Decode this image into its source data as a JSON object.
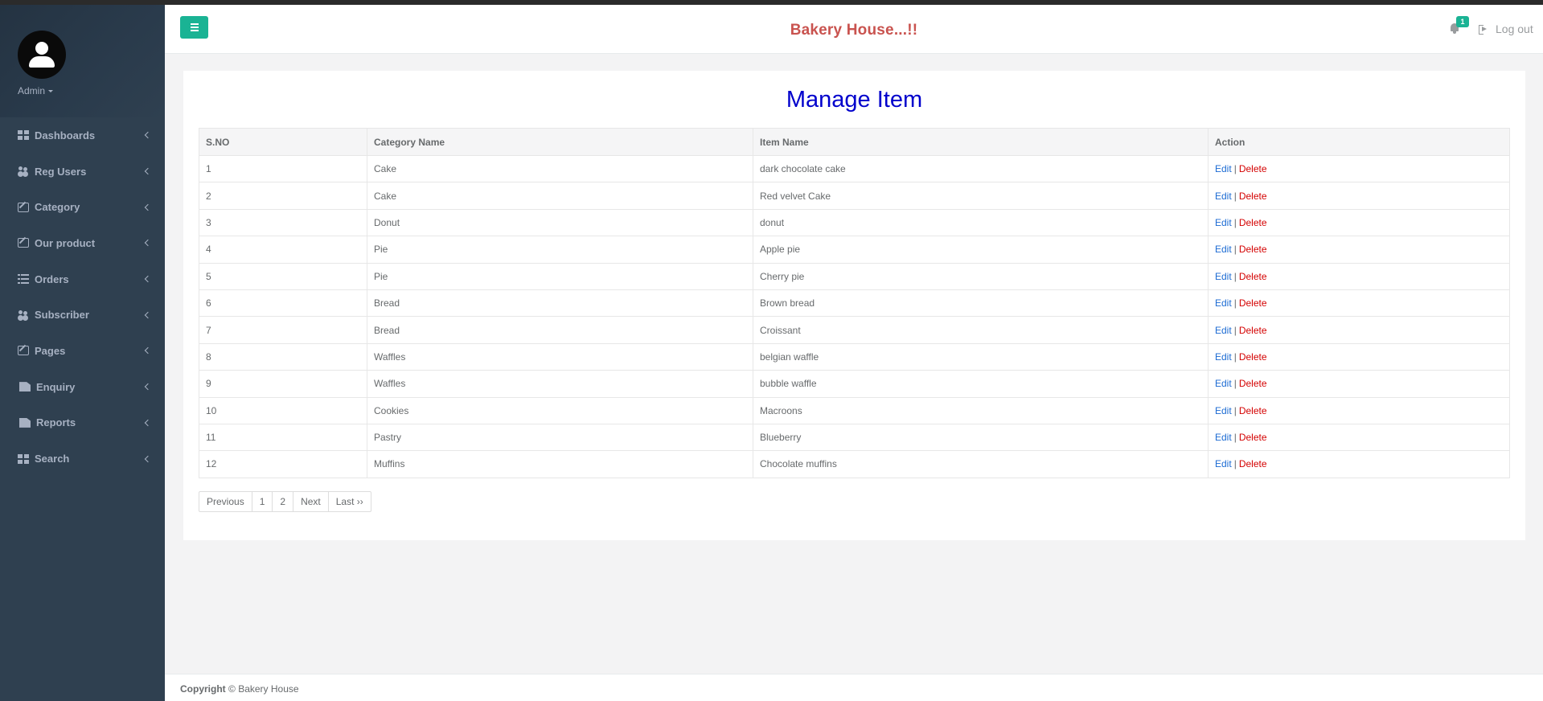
{
  "header": {
    "brand": "Bakery House...!!",
    "notification_count": "1",
    "logout_label": "Log out"
  },
  "sidebar": {
    "user_name": "Admin",
    "items": [
      {
        "label": "Dashboards",
        "icon": "th-large-icon"
      },
      {
        "label": "Reg Users",
        "icon": "users-icon"
      },
      {
        "label": "Category",
        "icon": "edit-icon"
      },
      {
        "label": "Our product",
        "icon": "edit-icon"
      },
      {
        "label": "Orders",
        "icon": "list-icon"
      },
      {
        "label": "Subscriber",
        "icon": "users-icon"
      },
      {
        "label": "Pages",
        "icon": "edit-icon"
      },
      {
        "label": "Enquiry",
        "icon": "file-icon"
      },
      {
        "label": "Reports",
        "icon": "file-icon"
      },
      {
        "label": "Search",
        "icon": "th-large-icon"
      }
    ]
  },
  "main": {
    "title": "Manage Item",
    "columns": [
      "S.NO",
      "Category Name",
      "Item Name",
      "Action"
    ],
    "action_edit": "Edit",
    "action_sep": "|",
    "action_delete": "Delete",
    "rows": [
      {
        "sno": "1",
        "category": "Cake",
        "item": "dark chocolate cake"
      },
      {
        "sno": "2",
        "category": "Cake",
        "item": "Red velvet Cake"
      },
      {
        "sno": "3",
        "category": "Donut",
        "item": "donut"
      },
      {
        "sno": "4",
        "category": "Pie",
        "item": "Apple pie"
      },
      {
        "sno": "5",
        "category": "Pie",
        "item": "Cherry pie"
      },
      {
        "sno": "6",
        "category": "Bread",
        "item": "Brown bread"
      },
      {
        "sno": "7",
        "category": "Bread",
        "item": "Croissant"
      },
      {
        "sno": "8",
        "category": "Waffles",
        "item": "belgian waffle"
      },
      {
        "sno": "9",
        "category": "Waffles",
        "item": "bubble waffle"
      },
      {
        "sno": "10",
        "category": "Cookies",
        "item": "Macroons"
      },
      {
        "sno": "11",
        "category": "Pastry",
        "item": "Blueberry"
      },
      {
        "sno": "12",
        "category": "Muffins",
        "item": "Chocolate muffins"
      }
    ],
    "pagination": [
      "Previous",
      "1",
      "2",
      "Next",
      "Last ››"
    ]
  },
  "footer": {
    "copyright_label": "Copyright",
    "copyright_text": "© Bakery House"
  },
  "colors": {
    "sidebar": "#2f4050",
    "accent": "#1ab394",
    "brand": "#c9534f",
    "title": "#0000cc",
    "edit": "#1c6bd3",
    "delete": "#d40000"
  }
}
